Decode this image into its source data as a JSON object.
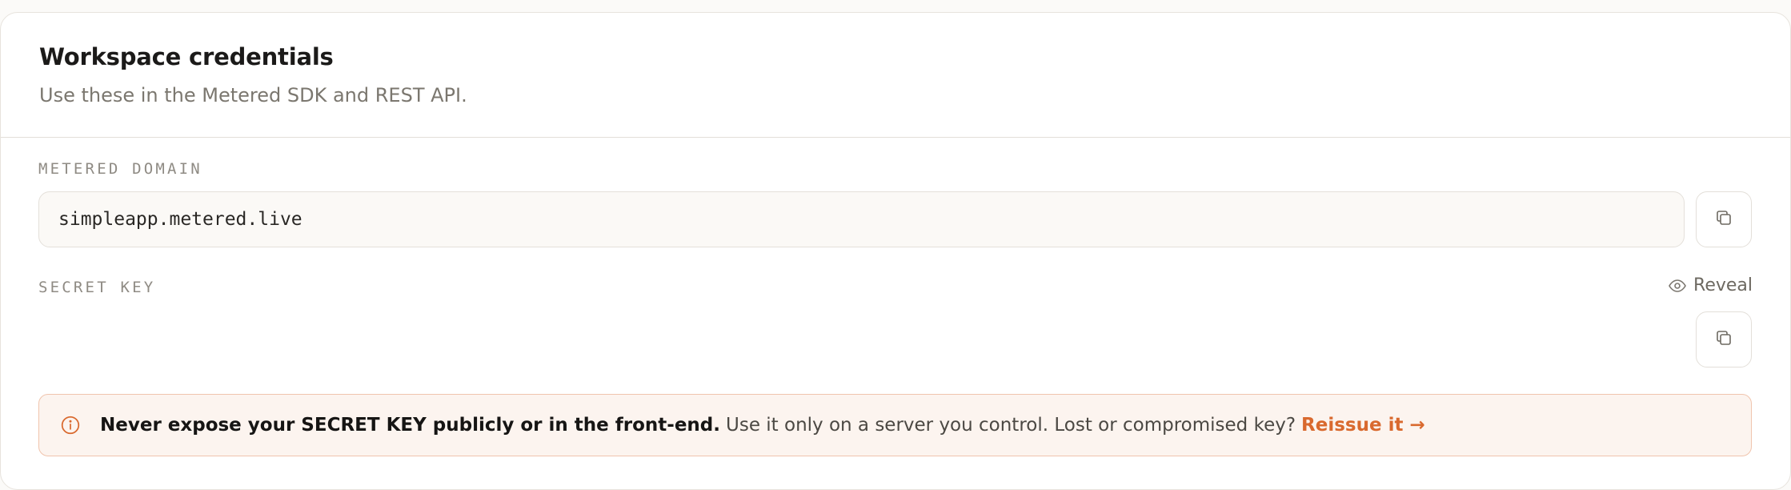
{
  "header": {
    "title": "Workspace credentials",
    "subtitle": "Use these in the Metered SDK and REST API."
  },
  "domain": {
    "label": "METERED DOMAIN",
    "value": "simpleapp.metered.live",
    "copy_icon": "copy-icon"
  },
  "secret": {
    "label": "SECRET KEY",
    "reveal_label": "Reveal",
    "reveal_icon": "eye-icon",
    "value": "",
    "copy_icon": "copy-icon"
  },
  "warning": {
    "icon": "info-icon",
    "strong": "Never expose your SECRET KEY publicly or in the front-end.",
    "text": "Use it only on a server you control. Lost or compromised key?",
    "link": "Reissue it →"
  },
  "colors": {
    "accent": "#d9692e",
    "warning_bg": "#fcf4ef",
    "warning_border": "#f0c4ad"
  }
}
